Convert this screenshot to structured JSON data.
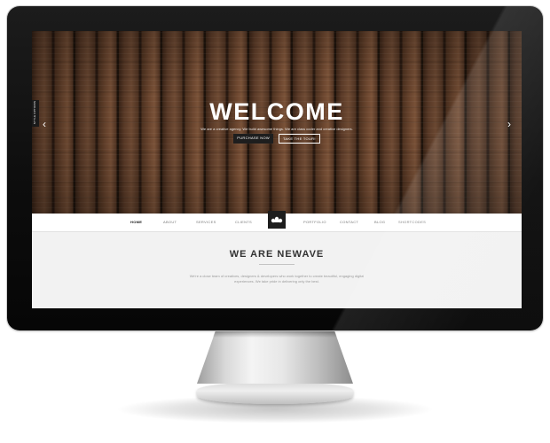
{
  "style_tab": {
    "label": "STYLE OPTIONS"
  },
  "hero": {
    "title": "WELCOME",
    "subtitle": "We are a creative agency. We build awesome things. We are class coder and creative designers.",
    "buttons": [
      {
        "label": "PURCHASE NOW"
      },
      {
        "label": "TAKE THE TOUR!"
      }
    ],
    "prev_icon": "chevron-left-icon",
    "next_icon": "chevron-right-icon"
  },
  "nav": {
    "items": [
      {
        "label": "HOME",
        "active": true
      },
      {
        "label": "ABOUT"
      },
      {
        "label": "SERVICES"
      },
      {
        "label": "CLIENTS"
      },
      {
        "label": "PORTFOLIO"
      },
      {
        "label": "CONTACT"
      },
      {
        "label": "BLOG"
      },
      {
        "label": "SHORTCODES"
      }
    ],
    "logo_icon": "newave-logo-icon"
  },
  "intro": {
    "title": "WE ARE NEWAVE",
    "text": "We're a close team of creatives, designers & developers who work together to create beautiful, engaging digital experiences. We take pride in delivering only the best."
  },
  "colors": {
    "accent_dark": "#1d1d1d",
    "nav_background": "#ffffff",
    "section_background": "#f2f2f2"
  }
}
